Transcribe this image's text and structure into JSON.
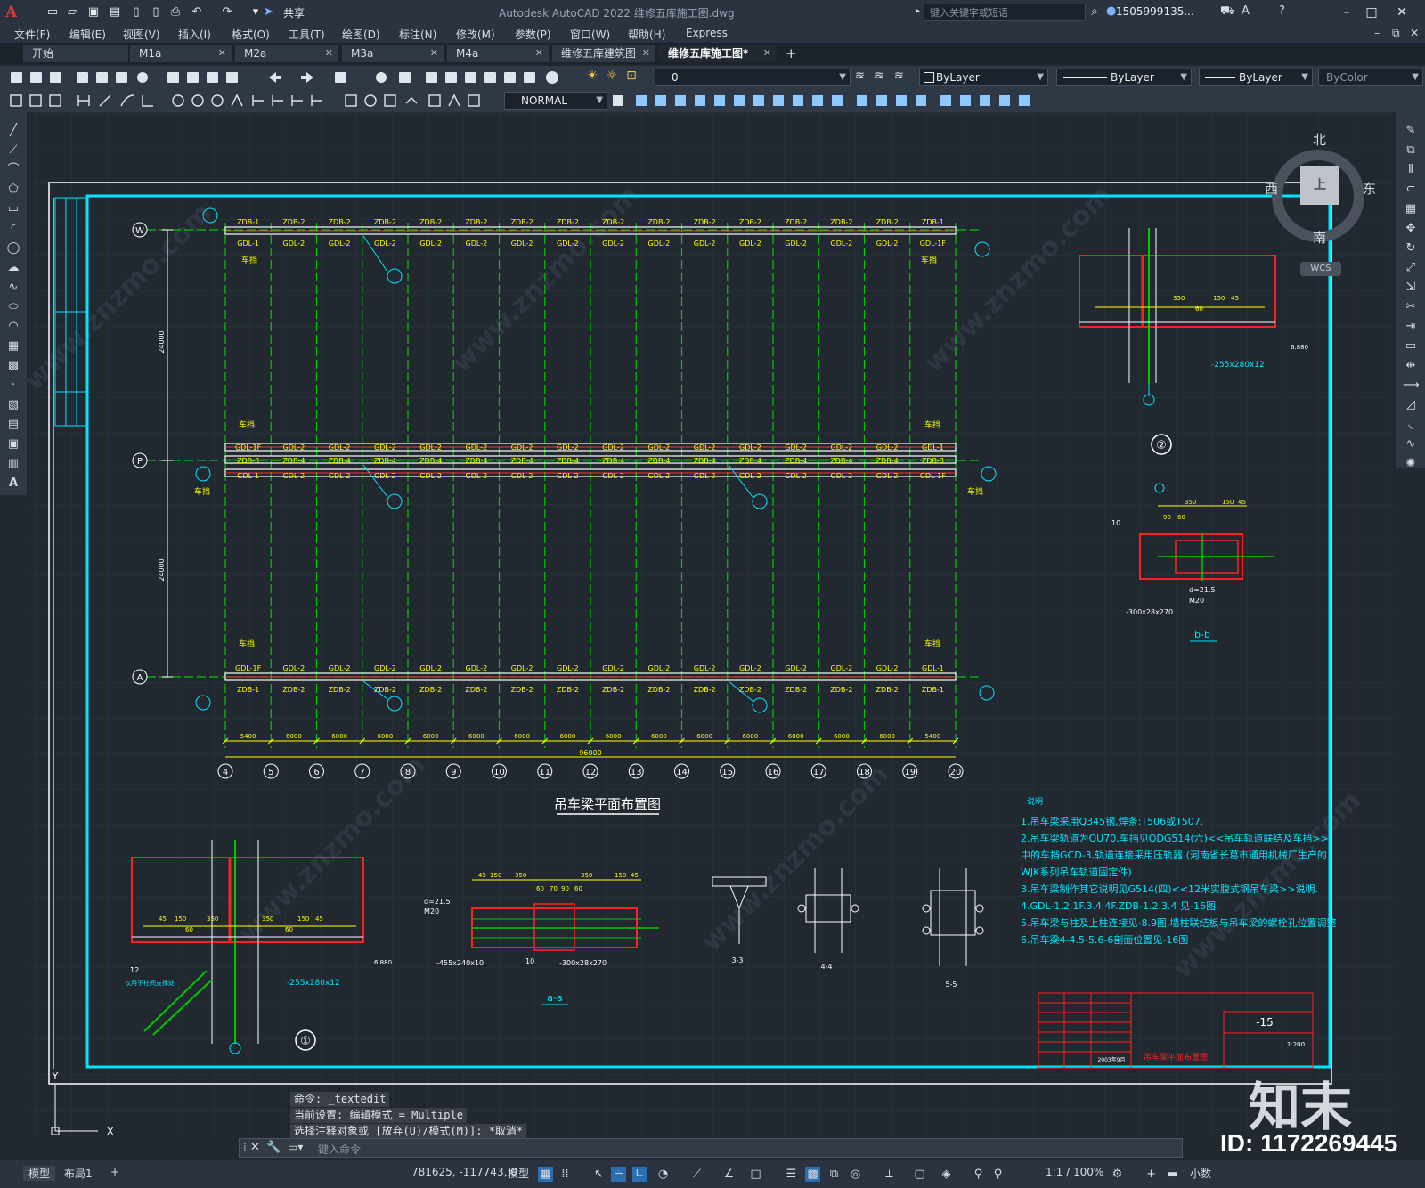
{
  "titlebar": {
    "app_logo": "A",
    "share_label": "共享",
    "app_title": "Autodesk AutoCAD 2022     维修五库施工图.dwg",
    "search_placeholder": "键入关键字或短语",
    "user_label": "1505999135...",
    "icons": [
      "new-icon",
      "open-icon",
      "save-icon",
      "saveas-icon",
      "plot-icon",
      "undo-icon",
      "redo-icon",
      "share-icon"
    ]
  },
  "menubar": {
    "items": [
      "文件(F)",
      "编辑(E)",
      "视图(V)",
      "插入(I)",
      "格式(O)",
      "工具(T)",
      "绘图(D)",
      "标注(N)",
      "修改(M)",
      "参数(P)",
      "窗口(W)",
      "帮助(H)",
      "Express"
    ]
  },
  "tabs": {
    "items": [
      {
        "label": "开始",
        "active": false
      },
      {
        "label": "M1a",
        "active": false
      },
      {
        "label": "M2a",
        "active": false
      },
      {
        "label": "M3a",
        "active": false
      },
      {
        "label": "M4a",
        "active": false
      },
      {
        "label": "维修五库建筑图",
        "active": false
      },
      {
        "label": "维修五库施工图*",
        "active": true
      }
    ],
    "add_label": "+"
  },
  "toolbar": {
    "layer_value": "0",
    "color_value": "ByLayer",
    "linetype_value": "ByLayer",
    "lineweight_value": "ByLayer",
    "plotstyle_value": "ByColor",
    "textstyle_value": "NORMAL"
  },
  "viewcube": {
    "north": "北",
    "south": "南",
    "east": "东",
    "west": "西",
    "top": "上",
    "wcs": "WCS"
  },
  "drawing": {
    "main_title": "吊车梁平面布置图",
    "row_labels": [
      "W",
      "P",
      "A"
    ],
    "column_labels": [
      "4",
      "5",
      "6",
      "7",
      "8",
      "9",
      "10",
      "11",
      "12",
      "13",
      "14",
      "15",
      "16",
      "17",
      "18",
      "19",
      "20"
    ],
    "beam_top": [
      "ZDB-1",
      "ZDB-2",
      "ZDB-2",
      "ZDB-2",
      "ZDB-2",
      "ZDB-2",
      "ZDB-2",
      "ZDB-2",
      "ZDB-2",
      "ZDB-2",
      "ZDB-2",
      "ZDB-2",
      "ZDB-2",
      "ZDB-2",
      "ZDB-2",
      "ZDB-1"
    ],
    "gdl_row1": [
      "GDL-1",
      "GDL-2",
      "GDL-2",
      "GDL-2",
      "GDL-2",
      "GDL-2",
      "GDL-2",
      "GDL-2",
      "GDL-2",
      "GDL-2",
      "GDL-2",
      "GDL-2",
      "GDL-2",
      "GDL-2",
      "GDL-2",
      "GDL-1F"
    ],
    "gdl_row2": [
      "GDL-1F",
      "GDL-2",
      "GDL-2",
      "GDL-2",
      "GDL-2",
      "GDL-2",
      "GDL-2",
      "GDL-2",
      "GDL-2",
      "GDL-2",
      "GDL-2",
      "GDL-2",
      "GDL-2",
      "GDL-2",
      "GDL-2",
      "GDL-1"
    ],
    "zdb_row2": [
      "ZDB-3",
      "ZDB-4",
      "ZDB-4",
      "ZDB-4",
      "ZDB-4",
      "ZDB-4",
      "ZDB-4",
      "ZDB-4",
      "ZDB-4",
      "ZDB-4",
      "ZDB-4",
      "ZDB-4",
      "ZDB-4",
      "ZDB-4",
      "ZDB-4",
      "ZDB-3"
    ],
    "gdl_row3": [
      "GDL-1",
      "GDL-2",
      "GDL-2",
      "GDL-2",
      "GDL-2",
      "GDL-2",
      "GDL-2",
      "GDL-2",
      "GDL-2",
      "GDL-2",
      "GDL-2",
      "GDL-2",
      "GDL-2",
      "GDL-2",
      "GDL-2",
      "GDL-1F"
    ],
    "gdl_row4": [
      "GDL-1F",
      "GDL-2",
      "GDL-2",
      "GDL-2",
      "GDL-2",
      "GDL-2",
      "GDL-2",
      "GDL-2",
      "GDL-2",
      "GDL-2",
      "GDL-2",
      "GDL-2",
      "GDL-2",
      "GDL-2",
      "GDL-2",
      "GDL-1"
    ],
    "beam_bottom": [
      "ZDB-1",
      "ZDB-2",
      "ZDB-2",
      "ZDB-2",
      "ZDB-2",
      "ZDB-2",
      "ZDB-2",
      "ZDB-2",
      "ZDB-2",
      "ZDB-2",
      "ZDB-2",
      "ZDB-2",
      "ZDB-2",
      "ZDB-2",
      "ZDB-2",
      "ZDB-1"
    ],
    "stop_label": "车挡",
    "dim_spans": [
      "5400",
      "6000",
      "6000",
      "6000",
      "6000",
      "6000",
      "6000",
      "6000",
      "6000",
      "6000",
      "6000",
      "6000",
      "6000",
      "6000",
      "6000",
      "5400"
    ],
    "dim_total": "96000",
    "dim_vertical": [
      "24000",
      "24000"
    ],
    "detail_markers": [
      "①",
      "②"
    ],
    "section_labels": [
      "a-a",
      "b-b",
      "3-3",
      "4-4",
      "5-5"
    ],
    "detail2": {
      "plate": "-255x280x12",
      "dims": [
        "350",
        "150",
        "45",
        "60"
      ],
      "elev": "6.880"
    },
    "detail_bb": {
      "dims": [
        "350",
        "150",
        "45",
        "90",
        "60"
      ],
      "bolt": "d=21.5",
      "bolt_size": "M20",
      "plate": "-300x28x270",
      "weld": "10"
    },
    "detail1": {
      "plate": "-255x280x12",
      "dims": [
        "45",
        "150",
        "350",
        "350",
        "150",
        "45",
        "60",
        "60"
      ],
      "elev": "6.880",
      "note": "仅用于柱间支撑处",
      "weld": "12"
    },
    "detail_aa": {
      "bolt": "d=21.5",
      "bolt_size": "M20",
      "dims": [
        "45",
        "150",
        "350",
        "60",
        "70",
        "90",
        "60",
        "350",
        "150",
        "45"
      ],
      "plate1": "-455x240x10",
      "plate2": "-300x28x270",
      "weld": "10"
    },
    "notes_title": "说明",
    "notes": [
      "1.吊车梁采用Q345钢,焊条:T506或T507.",
      "2.吊车梁轨道为QU70,车挡见QDG514(六)<<吊车轨道联结及车挡>>",
      "   中的车挡GCD-3,轨道连接采用压轨器.(河南省长葛市通用机械厂生产的",
      "   WJK系列吊车轨道固定件)",
      "3.吊车梁制作其它说明见G514(四)<<12米实腹式钢吊车梁>>说明.",
      "4.GDL-1.2.1F.3.4.4F.ZDB-1.2.3.4 见-16图.",
      "5.吊车梁与柱及上柱连接见-8.9图,墙柱联结板与吊车梁的螺栓孔位置调整",
      "6.吊车梁4-4.5-5.6-6剖面位置见-16图"
    ],
    "titleblock": {
      "sheet": "-15",
      "name": "吊车梁平面布置图",
      "scale": "1:200",
      "date": "2003年9月"
    }
  },
  "command": {
    "history": [
      "命令: _textedit",
      "当前设置: 编辑模式 = Multiple",
      "选择注释对象或 [放弃(U)/模式(M)]: *取消*"
    ],
    "placeholder": "键入命令"
  },
  "statusbar": {
    "tabs": [
      "模型",
      "布局1"
    ],
    "add": "+",
    "coords": "781625, -117743, 0",
    "mode": "模型",
    "scale": "1:1 / 100%",
    "units": "小数"
  },
  "watermark": {
    "logo": "知末",
    "id": "ID: 1172269445"
  }
}
